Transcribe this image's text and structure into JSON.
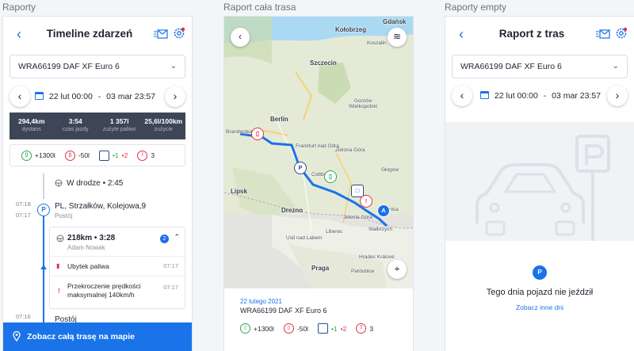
{
  "captions": [
    "Raporty",
    "Raport cała trasa",
    "Raporty empty"
  ],
  "timeline": {
    "title": "Timeline zdarzeń",
    "vehicle": "WRA66199 DAF XF Euro 6",
    "date_from": "22 lut 00:00",
    "date_sep": "-",
    "date_to": "03 mar 23:57",
    "stats": [
      {
        "value": "294,4km",
        "label": "dystans"
      },
      {
        "value": "3:54",
        "label": "czas jazdy"
      },
      {
        "value": "1 357l",
        "label": "zużyte paliwo"
      },
      {
        "value": "25,6l/100km",
        "label": "zużycie"
      }
    ],
    "summary": {
      "fuel_in": "+1300l",
      "fuel_out": "-50l",
      "park_a": "•1",
      "park_b": "•2",
      "alerts": "3"
    },
    "in_road": "W drodze  • 2:45",
    "stop1": {
      "time_a": "07:18",
      "time_b": "07:17",
      "address": "PL, Strzałków, Kolejowa,9",
      "status": "Postój"
    },
    "trip": {
      "summary": "218km  • 3:28",
      "driver": "Adam Nowak",
      "badge": "2"
    },
    "events": [
      {
        "label": "Ubytek paliwa",
        "time": "07:17"
      },
      {
        "label": "Przekroczenie prędkości maksymalnej 140km/h",
        "time": "07:17"
      }
    ],
    "stop2": {
      "time": "07:16",
      "status": "Postój"
    },
    "cta": "Zobacz całą trasę na mapie"
  },
  "route": {
    "map_labels": [
      "Kołobrzeg",
      "Gdańsk",
      "Koszalin",
      "Szczecin",
      "Gorzów Wielkopolski",
      "Berlin",
      "Zielona Góra",
      "Głogów",
      "Lipsk",
      "Drezno",
      "Jelenia Góra",
      "Legnica",
      "Wałbrzych",
      "Liberec",
      "Praga",
      "Usti nad Labem",
      "Hradec Králové",
      "Pardubice",
      "Frankfurt nad Odrą",
      "Cottbus",
      "Brandenburg"
    ],
    "date": "22 lutego 2021",
    "vehicle": "WRA66199 DAF XF Euro 6",
    "summary": {
      "fuel_in": "+1300l",
      "fuel_out": "-50l",
      "park_a": "•1",
      "park_b": "•2",
      "alerts": "3"
    }
  },
  "empty": {
    "title": "Raport z tras",
    "vehicle": "WRA66199 DAF XF Euro 6",
    "date_from": "22 lut 00:00",
    "date_sep": "-",
    "date_to": "03 mar 23:57",
    "message": "Tego dnia pojazd nie jeździł",
    "link": "Zobacz inne dni"
  },
  "colors": {
    "accent": "#1a73e8",
    "route": "#1a73e8",
    "fuel_in": "#2fa84f",
    "fuel_out": "#e0334a",
    "dark_bar": "#3d4656"
  }
}
